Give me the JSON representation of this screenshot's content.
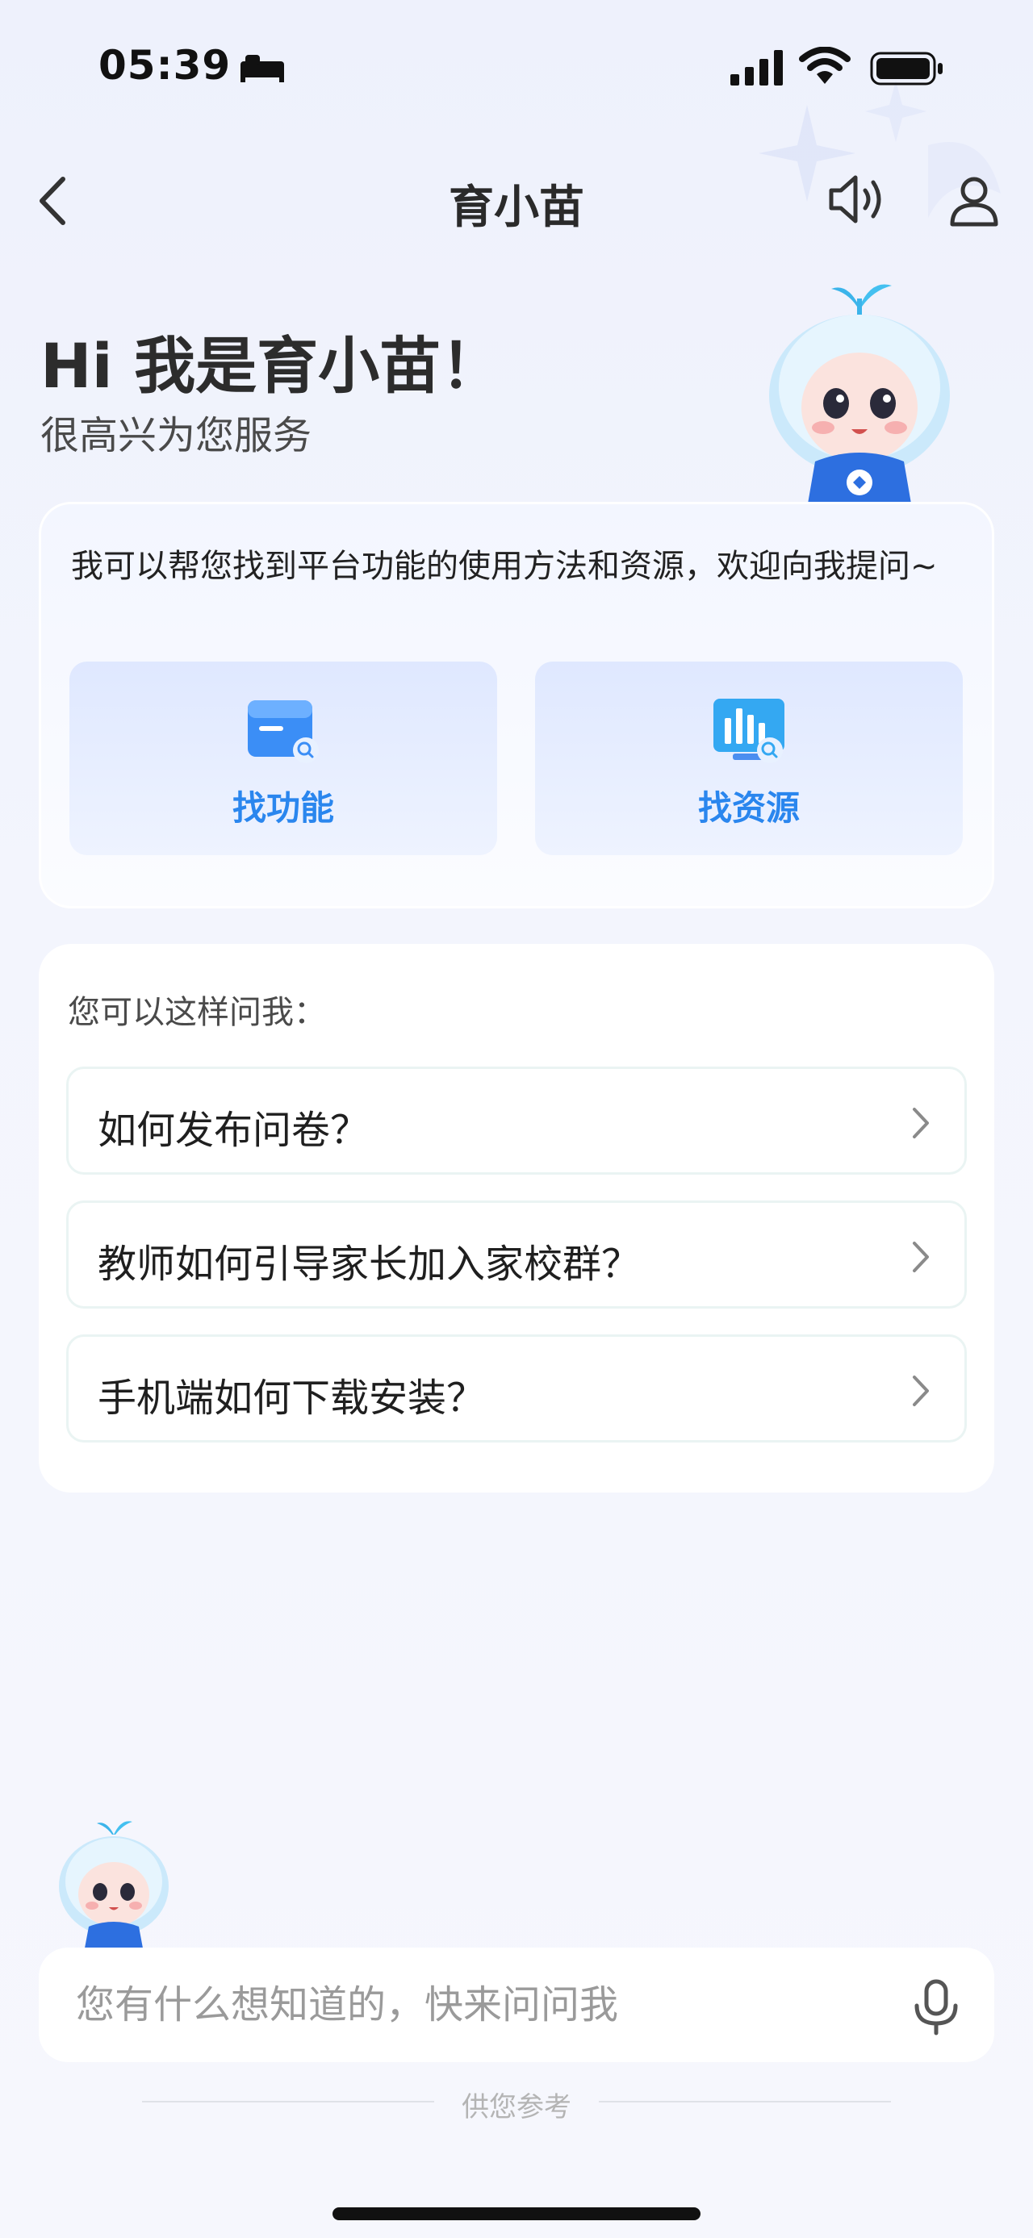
{
  "status_bar": {
    "time": "05:39"
  },
  "header": {
    "title": "育小苗"
  },
  "greeting": {
    "title": "Hi 我是育小苗！",
    "subtitle": "很高兴为您服务"
  },
  "intro": {
    "text": "我可以帮您找到平台功能的使用方法和资源，欢迎向我提问~",
    "buttons": [
      {
        "label": "找功能",
        "icon": "folder-search-icon"
      },
      {
        "label": "找资源",
        "icon": "chart-search-icon"
      }
    ]
  },
  "suggestions": {
    "heading": "您可以这样问我：",
    "items": [
      {
        "label": "如何发布问卷？"
      },
      {
        "label": "教师如何引导家长加入家校群？"
      },
      {
        "label": "手机端如何下载安装？"
      }
    ]
  },
  "input": {
    "placeholder": "您有什么想知道的，快来问问我"
  },
  "footer": {
    "text": "供您参考"
  },
  "colors": {
    "accent": "#2a86ee",
    "background": "#f3f5fd"
  }
}
